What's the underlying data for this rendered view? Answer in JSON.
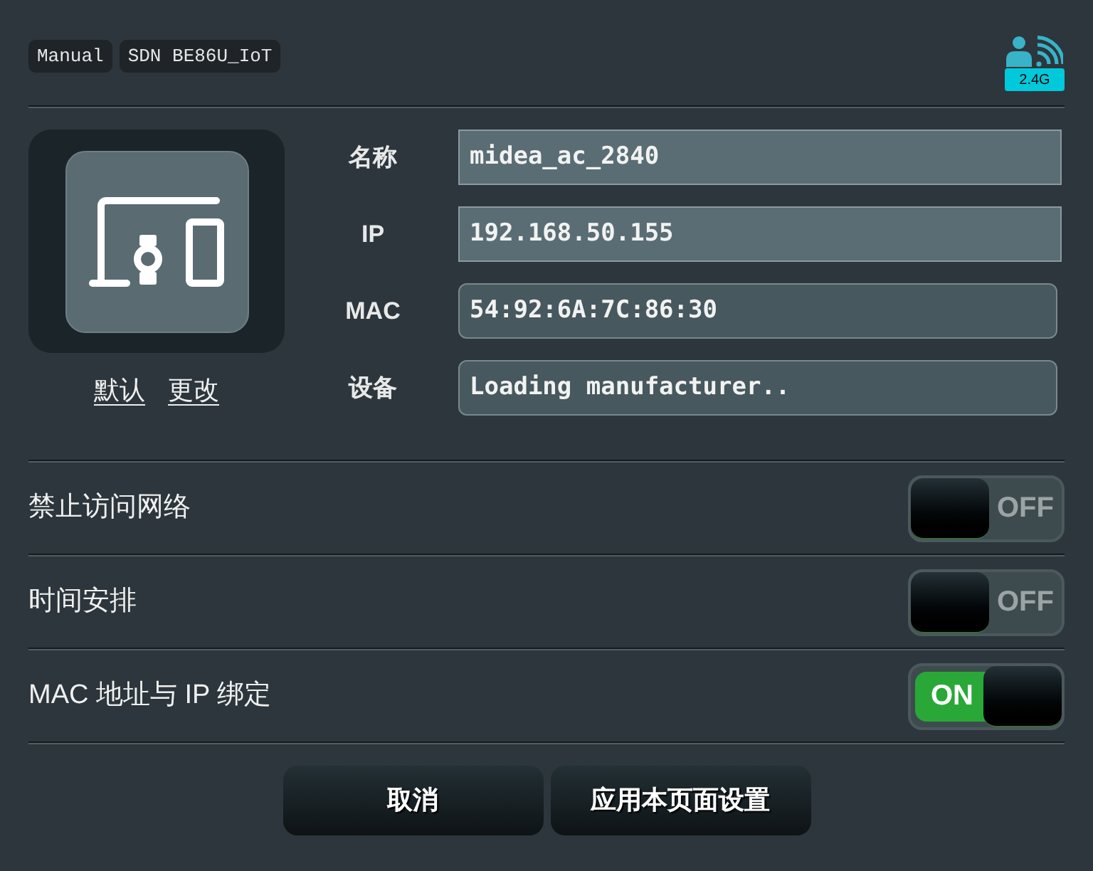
{
  "header": {
    "tags": [
      "Manual",
      "SDN BE86U_IoT"
    ],
    "band_badge": "2.4G"
  },
  "device": {
    "icon_links": [
      "默认",
      "更改"
    ],
    "fields": [
      {
        "label": "名称",
        "value": "midea_ac_2840",
        "kind": "editable"
      },
      {
        "label": "IP",
        "value": "192.168.50.155",
        "kind": "editable"
      },
      {
        "label": "MAC",
        "value": "54:92:6A:7C:86:30",
        "kind": "readonly"
      },
      {
        "label": "设备",
        "value": "Loading manufacturer..",
        "kind": "readonly"
      }
    ]
  },
  "settings": [
    {
      "label": "禁止访问网络",
      "on": false,
      "toggle_text": "OFF"
    },
    {
      "label": "时间安排",
      "on": false,
      "toggle_text": "OFF"
    },
    {
      "label": "MAC 地址与 IP 绑定",
      "on": true,
      "toggle_text": "ON"
    }
  ],
  "buttons": [
    "取消",
    "应用本页面设置"
  ]
}
